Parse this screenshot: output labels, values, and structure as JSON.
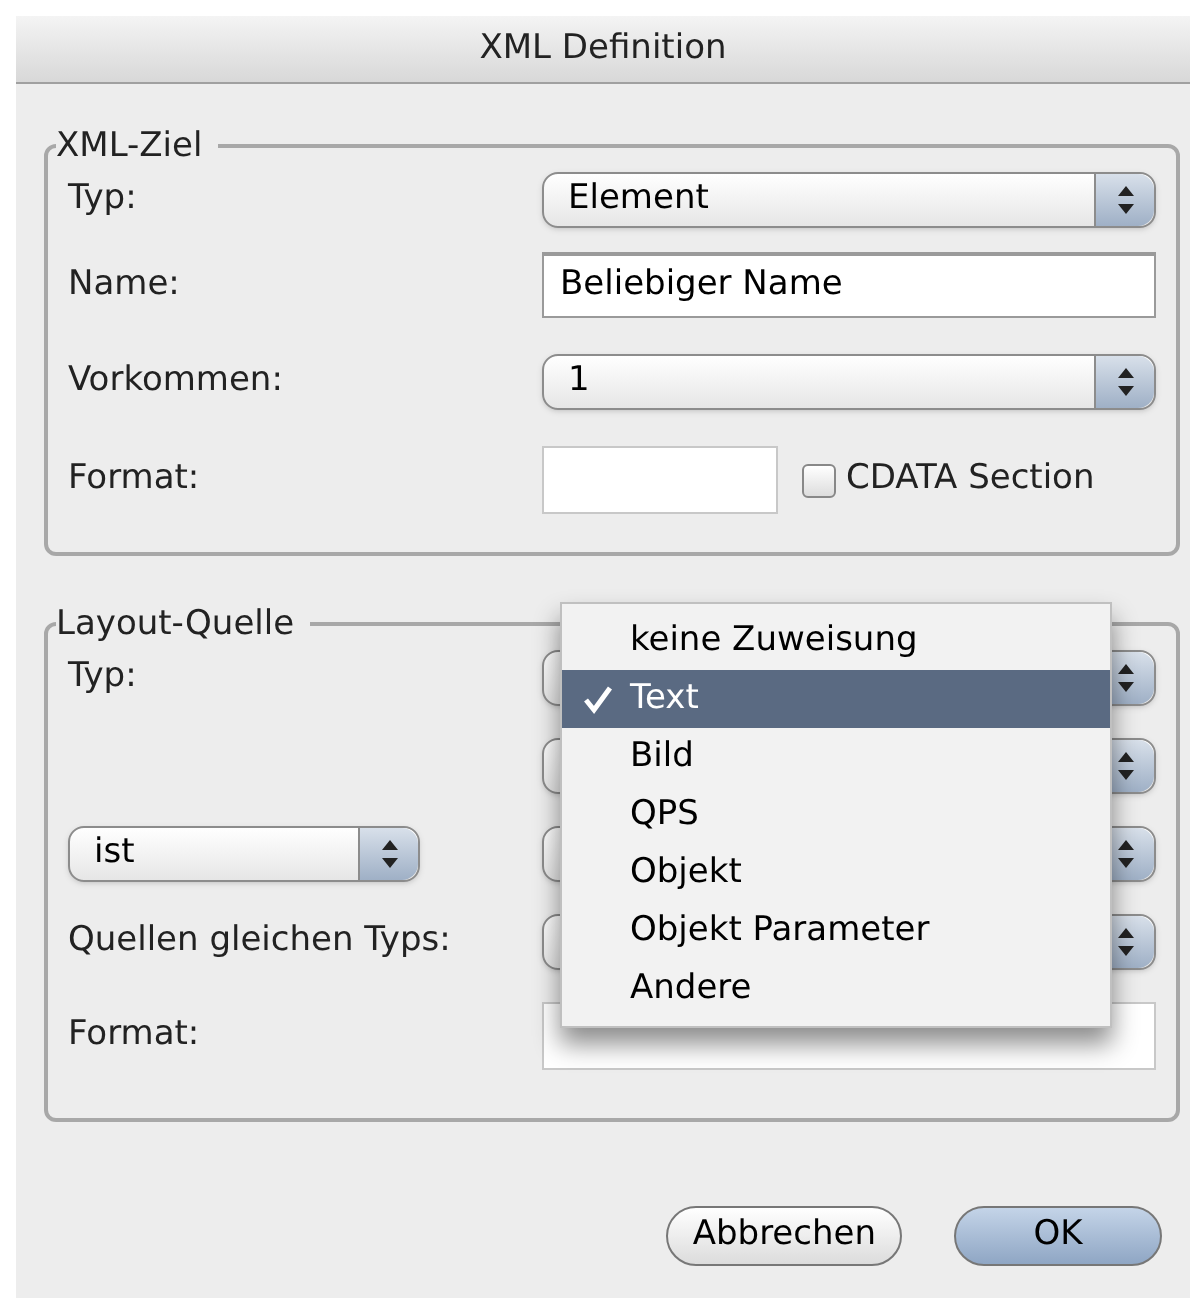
{
  "window": {
    "title": "XML Definition"
  },
  "target": {
    "title": "XML-Ziel",
    "type_label": "Typ:",
    "type_value": "Element",
    "name_label": "Name:",
    "name_value": "Beliebiger Name",
    "occurrence_label": "Vorkommen:",
    "occurrence_value": "1",
    "format_label": "Format:",
    "cdata": {
      "label": "CDATA Section",
      "checked": false
    }
  },
  "source": {
    "title": "Layout-Quelle",
    "type_label": "Typ:",
    "condition_value": "ist",
    "same_type_label": "Quellen gleichen Typs:",
    "format_label": "Format:"
  },
  "menu": [
    {
      "label": "keine Zuweisung",
      "selected": false
    },
    {
      "label": "Text",
      "selected": true
    },
    {
      "label": "Bild",
      "selected": false
    },
    {
      "label": "QPS",
      "selected": false
    },
    {
      "label": "Objekt",
      "selected": false
    },
    {
      "label": "Objekt Parameter",
      "selected": false
    },
    {
      "label": "Andere",
      "selected": false
    }
  ],
  "buttons": [
    {
      "label": "Abbrechen",
      "kind": "cancel"
    },
    {
      "label": "OK",
      "kind": "default"
    }
  ]
}
